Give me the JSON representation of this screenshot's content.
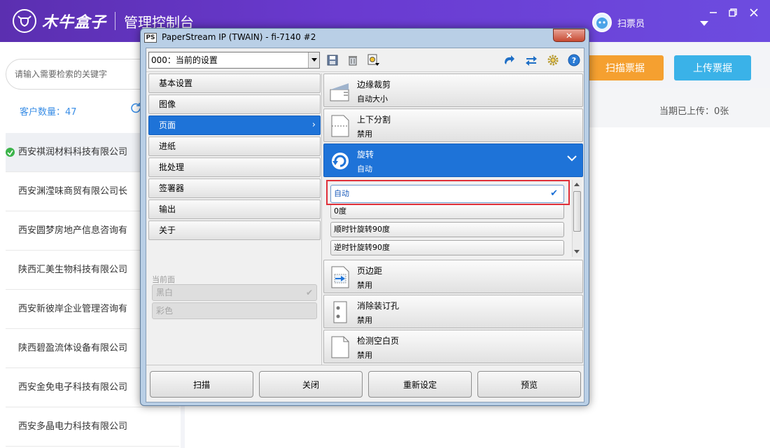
{
  "app": {
    "logo_text": "木牛盒子",
    "title": "管理控制台",
    "user_name": "扫票员"
  },
  "sidebar": {
    "search_placeholder": "请输入需要检索的关键字",
    "customer_count": "客户数量：47",
    "customers": [
      "西安祺润材料科技有限公司",
      "西安渊滢味商贸有限公司长",
      "西安圆梦房地产信息咨询有",
      "陕西汇美生物科技有限公司",
      "西安新彼岸企业管理咨询有",
      "陕西碧盈流体设备有限公司",
      "西安金免电子科技有限公司",
      "西安多晶电力科技有限公司"
    ]
  },
  "main": {
    "scan_button": "扫描票据",
    "upload_button": "上传票据",
    "uploaded_status": "当期已上传：0张"
  },
  "dialog": {
    "title": "PaperStream IP (TWAIN) - fi-7140 #2",
    "title_icon": "PS",
    "preset_value": "000：当前的设置",
    "nav_items": [
      "基本设置",
      "图像",
      "页面",
      "进纸",
      "批处理",
      "签署器",
      "输出",
      "关于"
    ],
    "current_side_label": "当前面",
    "current_options": [
      "黑白",
      "彩色"
    ],
    "settings": [
      {
        "title": "边缘裁剪",
        "sub": "自动大小"
      },
      {
        "title": "上下分割",
        "sub": "禁用"
      },
      {
        "title": "旋转",
        "sub": "自动"
      },
      {
        "title": "页边距",
        "sub": "禁用"
      },
      {
        "title": "消除装订孔",
        "sub": "禁用"
      },
      {
        "title": "检测空白页",
        "sub": "禁用"
      }
    ],
    "rotation_options": [
      "自动",
      "0度",
      "顺时针旋转90度",
      "逆时针旋转90度"
    ],
    "buttons": {
      "scan": "扫描",
      "close": "关闭",
      "reset": "重新设定",
      "preview": "预览"
    }
  },
  "colors": {
    "topbar": "#5b2fb0",
    "accent_blue": "#1e73d8",
    "scan_orange": "#f5a030",
    "upload_blue": "#3ab2e8",
    "highlight_red": "#e0303a"
  }
}
